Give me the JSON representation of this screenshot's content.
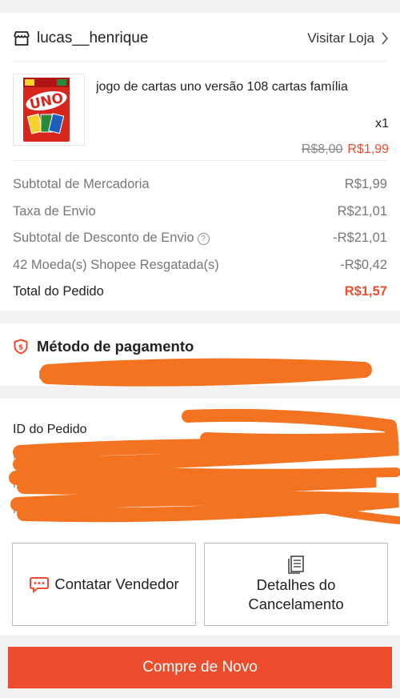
{
  "shop": {
    "name": "lucas__henrique",
    "visit_label": "Visitar Loja"
  },
  "product": {
    "name": "jogo de cartas uno versão 108 cartas família",
    "image_text": "UNO",
    "quantity": "x1",
    "original_price": "R$8,00",
    "price": "R$1,99"
  },
  "summary": {
    "rows": [
      {
        "label": "Subtotal de Mercadoria",
        "value": "R$1,99"
      },
      {
        "label": "Taxa de Envio",
        "value": "R$21,01"
      },
      {
        "label": "Subtotal de Desconto de Envio",
        "value": "-R$21,01"
      },
      {
        "label": "42 Moeda(s) Shopee Resgatada(s)",
        "value": "-R$0,42"
      }
    ],
    "total_label": "Total do Pedido",
    "total_value": "R$1,57"
  },
  "payment": {
    "title": "Método de pagamento",
    "value_prefix": "N"
  },
  "order": {
    "id_label": "ID do Pedido",
    "row2_prefix": "H",
    "row3_prefix": "P",
    "row4_prefix": "P"
  },
  "buttons": {
    "contact_label": "Contatar Vendedor",
    "cancel_line1": "Detalhes do",
    "cancel_line2": "Cancelamento",
    "buy_again_label": "Compre de Novo"
  },
  "colors": {
    "accent": "#ee4d2d",
    "redaction": "#f47321"
  },
  "icons": [
    "store-icon",
    "chevron-right-icon",
    "help-icon",
    "shield-pay-icon",
    "chat-icon",
    "document-icon"
  ]
}
